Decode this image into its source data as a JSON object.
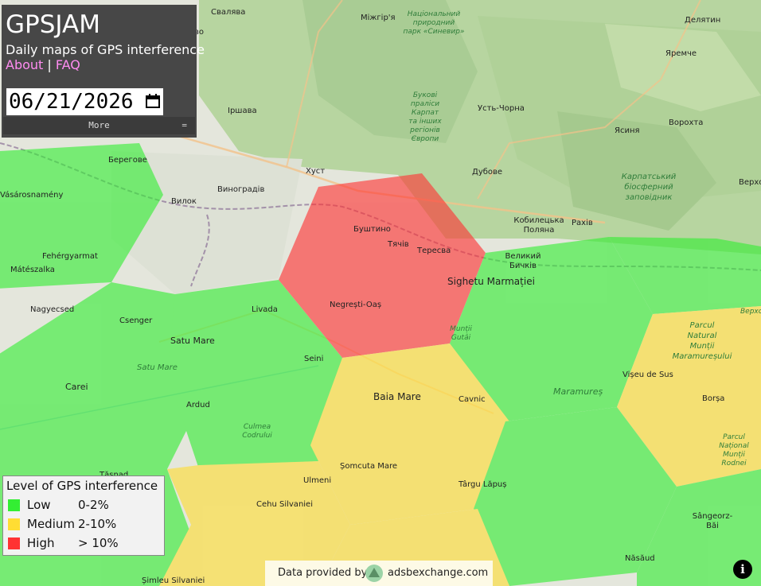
{
  "app": {
    "title": "GPSJAM",
    "subtitle": "Daily maps of GPS interference",
    "link_about": "About",
    "link_separator": "|",
    "link_faq": "FAQ",
    "date_value": "06/21/2026",
    "more_label": "More",
    "more_icon": "hamburger-icon"
  },
  "legend": {
    "title": "Level of GPS interference",
    "levels": [
      {
        "label": "Low",
        "range": "0-2%",
        "color": "#33ee33"
      },
      {
        "label": "Medium",
        "range": "2-10%",
        "color": "#ffdd33"
      },
      {
        "label": "High",
        "range": "> 10%",
        "color": "#ff3333"
      }
    ]
  },
  "attribution": {
    "text": "Data provided by",
    "domain": "adsbexchange.com",
    "logo_icon": "adsbexchange-logo-icon"
  },
  "info_button": {
    "label": "i",
    "icon": "info-icon"
  },
  "map": {
    "place_labels": {
      "svaliava": "Свалява",
      "vo": "во",
      "mizhhiria": "Міжгір'я",
      "synevyr_park": [
        "Національний",
        "природний",
        "парк «Синевир»"
      ],
      "delatyn": "Делятин",
      "yaremche": "Яремче",
      "yasynia": "Ясиня",
      "vorokhta": "Ворохта",
      "irshava": "Іршава",
      "bukovi_pralisy": [
        "Букові",
        "праліси",
        "Карпат",
        "та інших",
        "регіонів",
        "Європи"
      ],
      "ust_chorna": "Усть-Чорна",
      "beregove": "Берегове",
      "khust": "Хуст",
      "dubove": "Дубове",
      "karpatskyi_reserve": [
        "Карпатський",
        "біосферний",
        "заповідник"
      ],
      "verkhovyna": "Верхо",
      "vasarosnameny": "Vásárosnamény",
      "vylok": "Вилок",
      "vynohradiv": "Виноградів",
      "kobyletska_poliana": [
        "Кобилецька",
        "Поляна"
      ],
      "rakhiv": "Рахів",
      "bushtyno": "Буштино",
      "tiachiv": "Тячів",
      "teresva": "Тересва",
      "velykyi_bychkiv": [
        "Великий",
        "Бичків"
      ],
      "fehergyarmat": "Fehérgyarmat",
      "mateszalka": "Mátészalka",
      "sighetu": "Sighetu Marmației",
      "nagyecsed": "Nagyecsed",
      "livada": "Livada",
      "negresti_oas": "Negrești-Oaș",
      "csenger": "Csenger",
      "verkhovyna2": "Верхо",
      "muntii_maramuresului": [
        "Parcul",
        "Natural",
        "Munții",
        "Maramureșului"
      ],
      "muntii_gutai": [
        "Munții",
        "Gutâi"
      ],
      "satu_mare": "Satu Mare",
      "satu_mare_county": "Satu Mare",
      "seini": "Seini",
      "viseu": "Vișeu de Sus",
      "carei": "Carei",
      "baia_mare": "Baia Mare",
      "cavnic": "Cavnic",
      "maramures": "Maramureș",
      "borsa": "Borșa",
      "ardud": "Ardud",
      "culmea_codrului": [
        "Culmea",
        "Codrului"
      ],
      "rodnei_park": [
        "Parcul",
        "Național",
        "Munții",
        "Rodnei"
      ],
      "somcuta": "Șomcuta Mare",
      "ulmeni": "Ulmeni",
      "targu_lapus": "Târgu Lăpuș",
      "cehu": "Cehu Silvaniei",
      "sangeorz": [
        "Sângeorz-",
        "Băi"
      ],
      "tasnad": "Tășnad",
      "nasaud": "Năsăud",
      "simleu": "Șimleu Silvaniei"
    },
    "hex_levels": [
      "low",
      "low",
      "low",
      "low",
      "high",
      "low",
      "low",
      "medium",
      "medium",
      "medium",
      "low",
      "low",
      "medium",
      "low"
    ]
  }
}
